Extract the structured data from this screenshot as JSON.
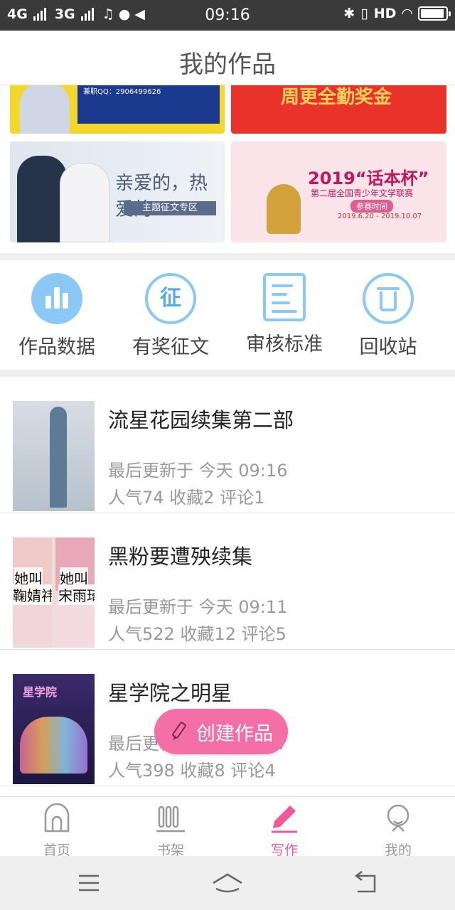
{
  "status_bar": {
    "network_1": "4G",
    "network_2": "3G",
    "time": "09:16",
    "hd_label": "HD",
    "icons": [
      "signal-icon",
      "music-icon",
      "wechat-icon",
      "mute-icon",
      "bluetooth-icon",
      "vibrate-icon",
      "wifi-icon",
      "battery-icon"
    ]
  },
  "header": {
    "title": "我的作品"
  },
  "banners": [
    {
      "name": "recruit-banner",
      "text": "兼职QQ：2906499626",
      "color": "#f3d72a"
    },
    {
      "name": "attendance-bonus-banner",
      "text": "周更全勤奖金",
      "color": "#e8322a"
    },
    {
      "name": "theme-contest-banner",
      "text": "亲爱的，热爱的",
      "subtext": "主题征文专区",
      "color": "#dfe6ef"
    },
    {
      "name": "huamu-cup-banner",
      "text": "2019“话本杯”",
      "subtext": "第二届全国青少年文学联赛",
      "tag": "参赛时间",
      "dates": "2019.6.20 - 2019.10.07",
      "color": "#fbe3ea"
    }
  ],
  "quick_actions": [
    {
      "label": "作品数据",
      "icon": "bar-chart-icon"
    },
    {
      "label": "有奖征文",
      "icon": "contest-icon",
      "glyph": "征"
    },
    {
      "label": "审核标准",
      "icon": "review-standard-icon"
    },
    {
      "label": "回收站",
      "icon": "trash-icon"
    }
  ],
  "works": [
    {
      "title": "流星花园续集第二部",
      "updated": "最后更新于 今天 09:16",
      "stats": "人气74 收藏2 评论1"
    },
    {
      "title": "黑粉要遭殃续集",
      "updated": "最后更新于 今天 09:11",
      "stats": "人气522 收藏12 评论5",
      "cover_captions": [
        "她叫",
        "她叫",
        "鞠婧祎",
        "宋雨琦"
      ]
    },
    {
      "title": "星学院之明星",
      "updated": "最后更新于 今天 09:07",
      "stats": "人气398 收藏8 评论4",
      "cover_logo": "星学院"
    }
  ],
  "fab": {
    "label": "创建作品",
    "icon": "pencil-icon"
  },
  "tab_bar": {
    "items": [
      {
        "label": "首页",
        "icon": "home-icon",
        "active": false
      },
      {
        "label": "书架",
        "icon": "bookshelf-icon",
        "active": false
      },
      {
        "label": "写作",
        "icon": "write-icon",
        "active": true
      },
      {
        "label": "我的",
        "icon": "profile-icon",
        "active": false
      }
    ],
    "active_color": "#f0589a"
  },
  "system_nav": [
    "menu-icon",
    "home-icon",
    "back-icon"
  ],
  "colors": {
    "accent_pink": "#f46fa6",
    "icon_blue": "#8cc8f5"
  }
}
